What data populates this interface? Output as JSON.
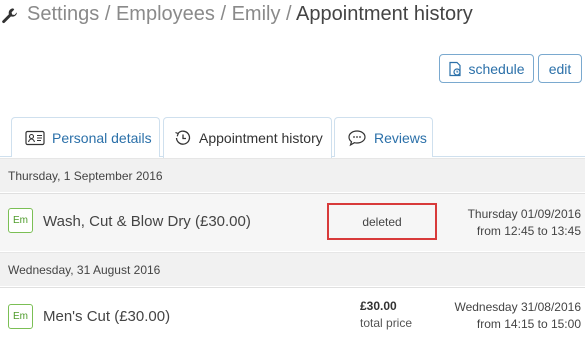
{
  "breadcrumb": {
    "items": [
      "Settings",
      "Employees",
      "Emily"
    ],
    "current": "Appointment history",
    "separator": "/"
  },
  "toolbar": {
    "schedule_label": "schedule",
    "edit_label": "edit"
  },
  "tabs": [
    {
      "label": "Personal details",
      "icon": "id-card-icon",
      "active": false
    },
    {
      "label": "Appointment history",
      "icon": "history-icon",
      "active": true
    },
    {
      "label": "Reviews",
      "icon": "speech-bubble-icon",
      "active": false
    }
  ],
  "days": [
    {
      "date": "Thursday, 1 September 2016",
      "appointments": [
        {
          "initials": "Em",
          "service": "Wash, Cut & Blow Dry (£30.00)",
          "status": "deleted",
          "date": "Thursday 01/09/2016",
          "time": "from 12:45 to 13:45"
        }
      ]
    },
    {
      "date": "Wednesday, 31 August 2016",
      "appointments": [
        {
          "initials": "Em",
          "service": "Men's Cut (£30.00)",
          "price": "£30.00",
          "price_label": "total price",
          "date": "Wednesday 31/08/2016",
          "time": "from 14:15 to 15:00"
        }
      ]
    }
  ],
  "colors": {
    "link": "#2b70a9",
    "badge_green": "#4d9b2a",
    "highlight_red": "#d83a3a"
  }
}
